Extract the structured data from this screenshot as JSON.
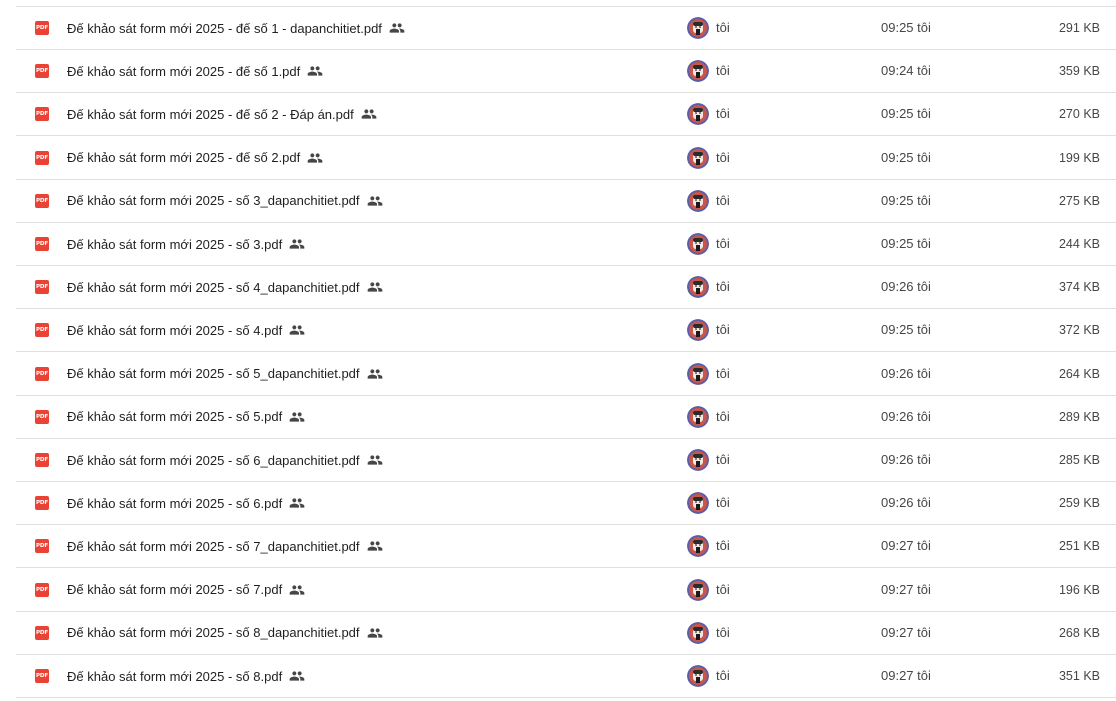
{
  "files": [
    {
      "name": "Đế khảo sát form mới 2025 - đế số 1 - dapanchitiet.pdf",
      "owner": "tôi",
      "modified": "09:25 tôi",
      "size": "291 KB",
      "icon": "pdf-icon",
      "shared": true
    },
    {
      "name": "Đế khảo sát form mới 2025 - đế số 1.pdf",
      "owner": "tôi",
      "modified": "09:24 tôi",
      "size": "359 KB",
      "icon": "pdf-icon",
      "shared": true
    },
    {
      "name": "Đế khảo sát form mới 2025 - đế số 2 - Đáp án.pdf",
      "owner": "tôi",
      "modified": "09:25 tôi",
      "size": "270 KB",
      "icon": "pdf-icon",
      "shared": true
    },
    {
      "name": "Đế khảo sát form mới 2025 - đế số 2.pdf",
      "owner": "tôi",
      "modified": "09:25 tôi",
      "size": "199 KB",
      "icon": "pdf-icon",
      "shared": true
    },
    {
      "name": "Đế khảo sát form mới 2025 - số 3_dapanchitiet.pdf",
      "owner": "tôi",
      "modified": "09:25 tôi",
      "size": "275 KB",
      "icon": "pdf-icon",
      "shared": true
    },
    {
      "name": "Đế khảo sát form mới 2025 - số 3.pdf",
      "owner": "tôi",
      "modified": "09:25 tôi",
      "size": "244 KB",
      "icon": "pdf-icon",
      "shared": true
    },
    {
      "name": "Đế khảo sát form mới 2025 - số 4_dapanchitiet.pdf",
      "owner": "tôi",
      "modified": "09:26 tôi",
      "size": "374 KB",
      "icon": "pdf-icon",
      "shared": true
    },
    {
      "name": "Đế khảo sát form mới 2025 - số 4.pdf",
      "owner": "tôi",
      "modified": "09:25 tôi",
      "size": "372 KB",
      "icon": "pdf-icon",
      "shared": true
    },
    {
      "name": "Đế khảo sát form mới 2025 - số 5_dapanchitiet.pdf",
      "owner": "tôi",
      "modified": "09:26 tôi",
      "size": "264 KB",
      "icon": "pdf-icon",
      "shared": true
    },
    {
      "name": "Đế khảo sát form mới 2025 - số 5.pdf",
      "owner": "tôi",
      "modified": "09:26 tôi",
      "size": "289 KB",
      "icon": "pdf-icon",
      "shared": true
    },
    {
      "name": "Đế khảo sát form mới 2025 - số 6_dapanchitiet.pdf",
      "owner": "tôi",
      "modified": "09:26 tôi",
      "size": "285 KB",
      "icon": "pdf-icon",
      "shared": true
    },
    {
      "name": "Đế khảo sát form mới 2025 - số 6.pdf",
      "owner": "tôi",
      "modified": "09:26 tôi",
      "size": "259 KB",
      "icon": "pdf-icon",
      "shared": true
    },
    {
      "name": "Đế khảo sát form mới 2025 - số 7_dapanchitiet.pdf",
      "owner": "tôi",
      "modified": "09:27 tôi",
      "size": "251 KB",
      "icon": "pdf-icon",
      "shared": true
    },
    {
      "name": "Đế khảo sát form mới 2025 - số 7.pdf",
      "owner": "tôi",
      "modified": "09:27 tôi",
      "size": "196 KB",
      "icon": "pdf-icon",
      "shared": true
    },
    {
      "name": "Đế khảo sát form mới 2025 - số 8_dapanchitiet.pdf",
      "owner": "tôi",
      "modified": "09:27 tôi",
      "size": "268 KB",
      "icon": "pdf-icon",
      "shared": true
    },
    {
      "name": "Đế khảo sát form mới 2025 - số 8.pdf",
      "owner": "tôi",
      "modified": "09:27 tôi",
      "size": "351 KB",
      "icon": "pdf-icon",
      "shared": true
    }
  ],
  "pdf_icon_label": "PDF",
  "colors": {
    "pdf_red": "#ea4335",
    "divider": "#e0e0e0",
    "secondary_text": "#444746",
    "avatar_bg": "#c9564b",
    "avatar_ring": "#5b5ea6"
  }
}
